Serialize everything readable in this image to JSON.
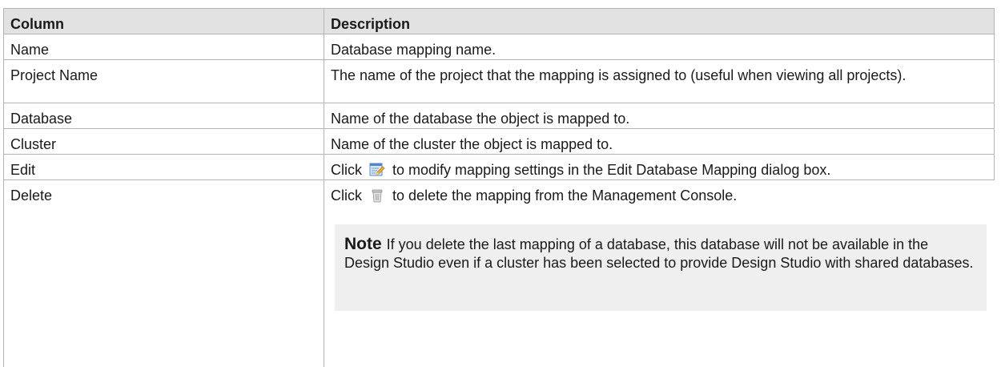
{
  "table": {
    "headers": {
      "column": "Column",
      "description": "Description"
    },
    "rows": [
      {
        "column": "Name",
        "description": "Database mapping name."
      },
      {
        "column": "Project Name",
        "description": "The name of the project that the mapping is assigned to (useful when viewing all projects)."
      },
      {
        "column": "Database",
        "description": "Name of the database the object is mapped to."
      },
      {
        "column": "Cluster",
        "description": "Name of the cluster the object is mapped to."
      },
      {
        "column": "Edit",
        "description_before": "Click",
        "description_after": "to modify mapping settings in the Edit Database Mapping dialog box.",
        "icon": "edit-icon"
      },
      {
        "column": "Delete",
        "description_before": "Click",
        "description_after": "to delete the mapping from the Management Console.",
        "icon": "trash-icon"
      }
    ],
    "note": {
      "label": "Note",
      "text": "If you delete the last mapping of a database, this database will not be available in the Design Studio even if a cluster has been selected to provide Design Studio with shared databases."
    }
  }
}
